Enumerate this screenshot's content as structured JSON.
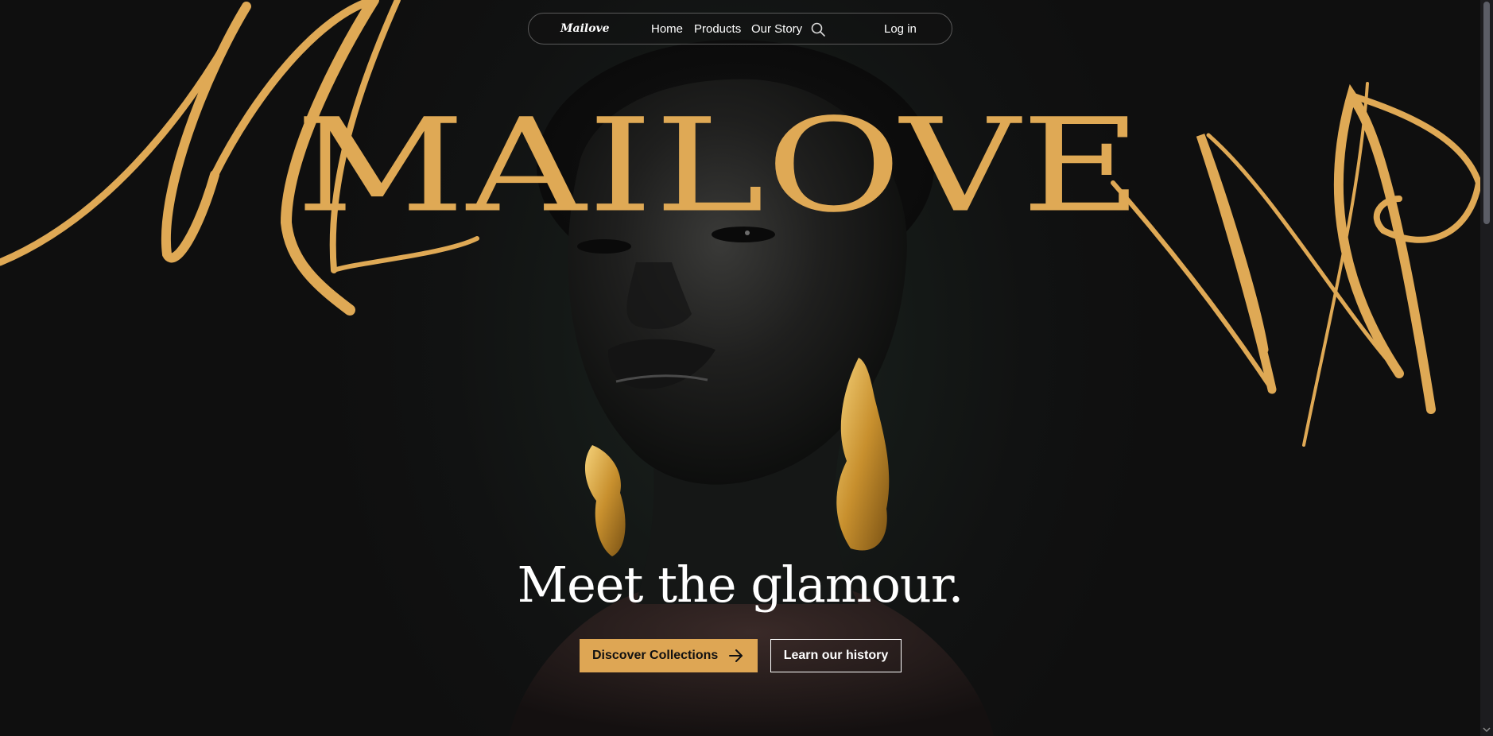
{
  "nav": {
    "brand": "Mailove",
    "links": [
      "Home",
      "Products",
      "Our Story"
    ],
    "search_icon": "search-icon",
    "login_label": "Log in"
  },
  "hero": {
    "wordmark": "MAILOVE",
    "headline": "Meet the glamour.",
    "primary_cta": "Discover Collections",
    "primary_cta_icon": "arrow-right-icon",
    "secondary_cta": "Learn our history"
  },
  "colors": {
    "accent": "#dea654",
    "background": "#111111",
    "text": "#ffffff"
  }
}
